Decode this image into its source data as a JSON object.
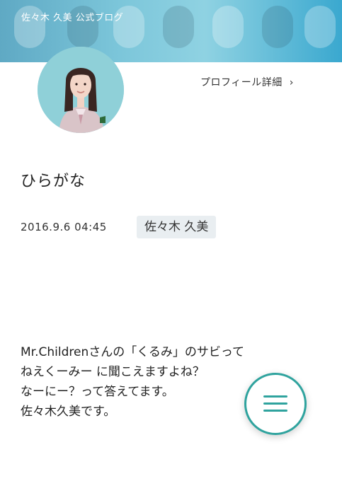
{
  "header": {
    "blog_title": "佐々木 久美 公式ブログ"
  },
  "profile": {
    "avatar_icon": "member-portrait",
    "detail_link": "プロフィール詳細",
    "detail_chevron": "›"
  },
  "post": {
    "title": "ひらがな",
    "date": "2016.9.6 04:45",
    "author": "佐々木 久美",
    "body": [
      "Mr.Childrenさんの「くるみ」のサビって",
      "ねえくーみー に聞こえますよね？",
      "なーにー？って答えてます。",
      "佐々木久美です。"
    ]
  },
  "menu": {
    "icon": "hamburger-menu-icon",
    "accent": "#2fa39e"
  }
}
